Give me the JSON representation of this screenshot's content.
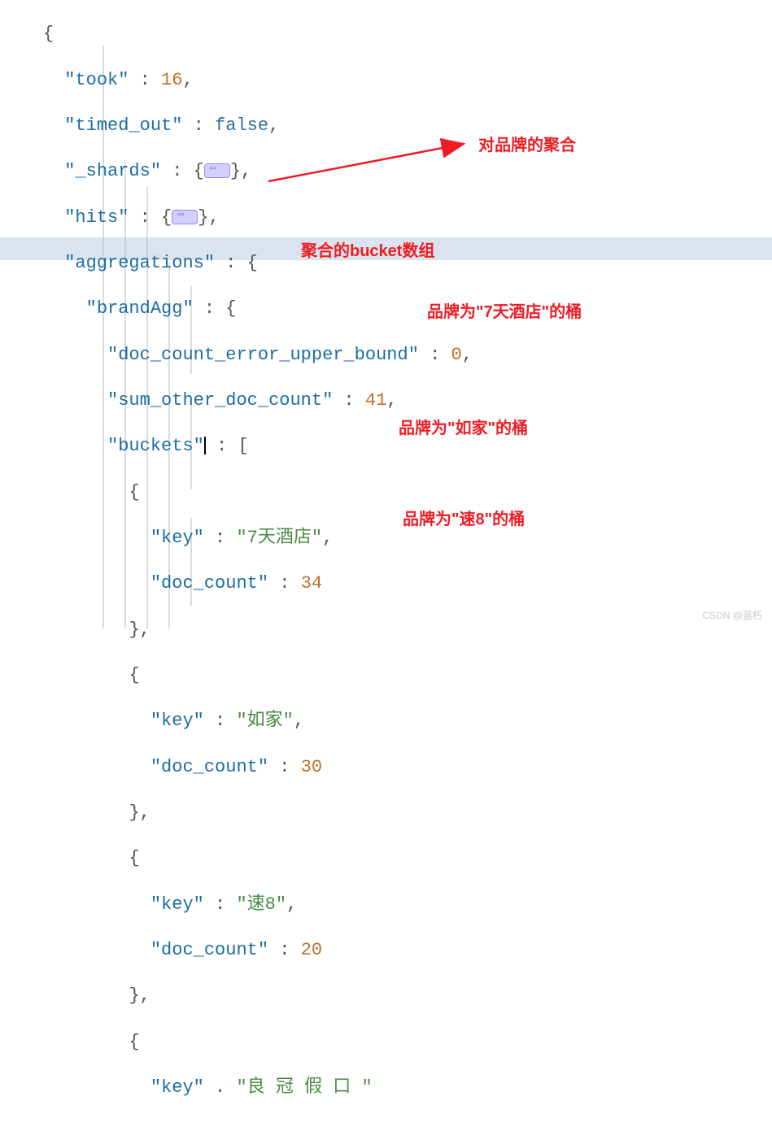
{
  "watermark": "CSDN @蓝朽",
  "annotations": {
    "brand_agg": "对品牌的聚合",
    "buckets": "聚合的bucket数组",
    "b1": "品牌为\"7天酒店\"的桶",
    "b2": "品牌为\"如家\"的桶",
    "b3": "品牌为\"速8\"的桶"
  },
  "json": {
    "took_key": "\"took\"",
    "took_val": "16",
    "timed_out_key": "\"timed_out\"",
    "timed_out_val": "false",
    "shards_key": "\"_shards\"",
    "hits_key": "\"hits\"",
    "aggs_key": "\"aggregations\"",
    "brandAgg_key": "\"brandAgg\"",
    "dceub_key": "\"doc_count_error_upper_bound\"",
    "dceub_val": "0",
    "sodc_key": "\"sum_other_doc_count\"",
    "sodc_val": "41",
    "buckets_key": "\"buckets\"",
    "b1_key_key": "\"key\"",
    "b1_key_val": "\"7天酒店\"",
    "b1_dc_key": "\"doc_count\"",
    "b1_dc_val": "34",
    "b2_key_key": "\"key\"",
    "b2_key_val": "\"如家\"",
    "b2_dc_key": "\"doc_count\"",
    "b2_dc_val": "30",
    "b3_key_key": "\"key\"",
    "b3_key_val": "\"速8\"",
    "b3_dc_key": "\"doc_count\"",
    "b3_dc_val": "20",
    "b4_key_key": "\"key\"",
    "b4_key_val_partial": "\"良 冠 假 口 \""
  }
}
